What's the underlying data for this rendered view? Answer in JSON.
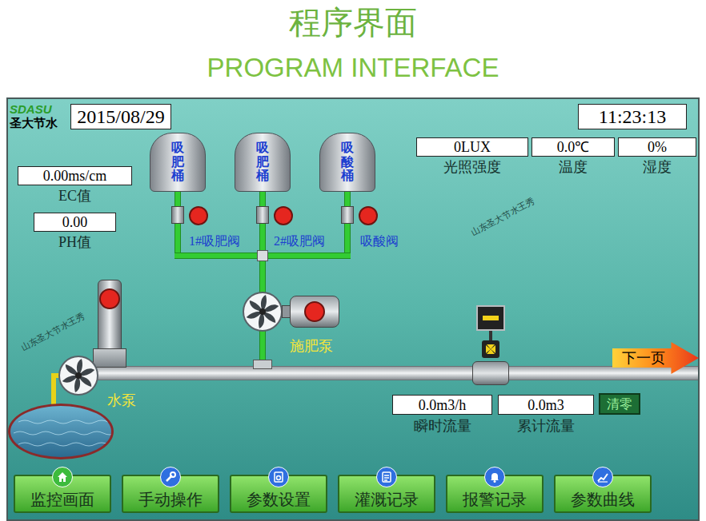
{
  "header": {
    "title": "程序界面",
    "subtitle": "PROGRAM INTERFACE"
  },
  "logo": {
    "brand": "SDASU",
    "name": "圣大节水"
  },
  "date": "2015/08/29",
  "time": "11:23:13",
  "sensors": [
    {
      "value": "0LUX",
      "label": "光照强度"
    },
    {
      "value": "0.0℃",
      "label": "温度"
    },
    {
      "value": "0%",
      "label": "湿度"
    }
  ],
  "ec": {
    "value": "0.00ms/cm",
    "label": "EC值"
  },
  "ph": {
    "value": "0.00",
    "label": "PH值"
  },
  "tanks": [
    {
      "label": "吸肥桶",
      "valve": "1#吸肥阀",
      "on": false
    },
    {
      "label": "吸肥桶",
      "valve": "2#吸肥阀",
      "on": false
    },
    {
      "label": "吸酸桶",
      "valve": "吸酸阀",
      "on": false
    }
  ],
  "fertilizer_pump": {
    "label": "施肥泵",
    "on": false
  },
  "water_pump": {
    "label": "水泵",
    "on": false
  },
  "flow": {
    "instant": {
      "value": "0.0m3/h",
      "label": "瞬时流量"
    },
    "total": {
      "value": "0.0m3",
      "label": "累计流量"
    },
    "reset": "清零"
  },
  "next_page": "下一页",
  "nav": [
    {
      "label": "监控画面",
      "selected": true
    },
    {
      "label": "手动操作",
      "selected": false
    },
    {
      "label": "参数设置",
      "selected": false
    },
    {
      "label": "灌溉记录",
      "selected": false
    },
    {
      "label": "报警记录",
      "selected": false
    },
    {
      "label": "参数曲线",
      "selected": false
    }
  ],
  "watermarks": [
    "山东圣大节水王秀",
    "山东圣大节水王秀"
  ]
}
